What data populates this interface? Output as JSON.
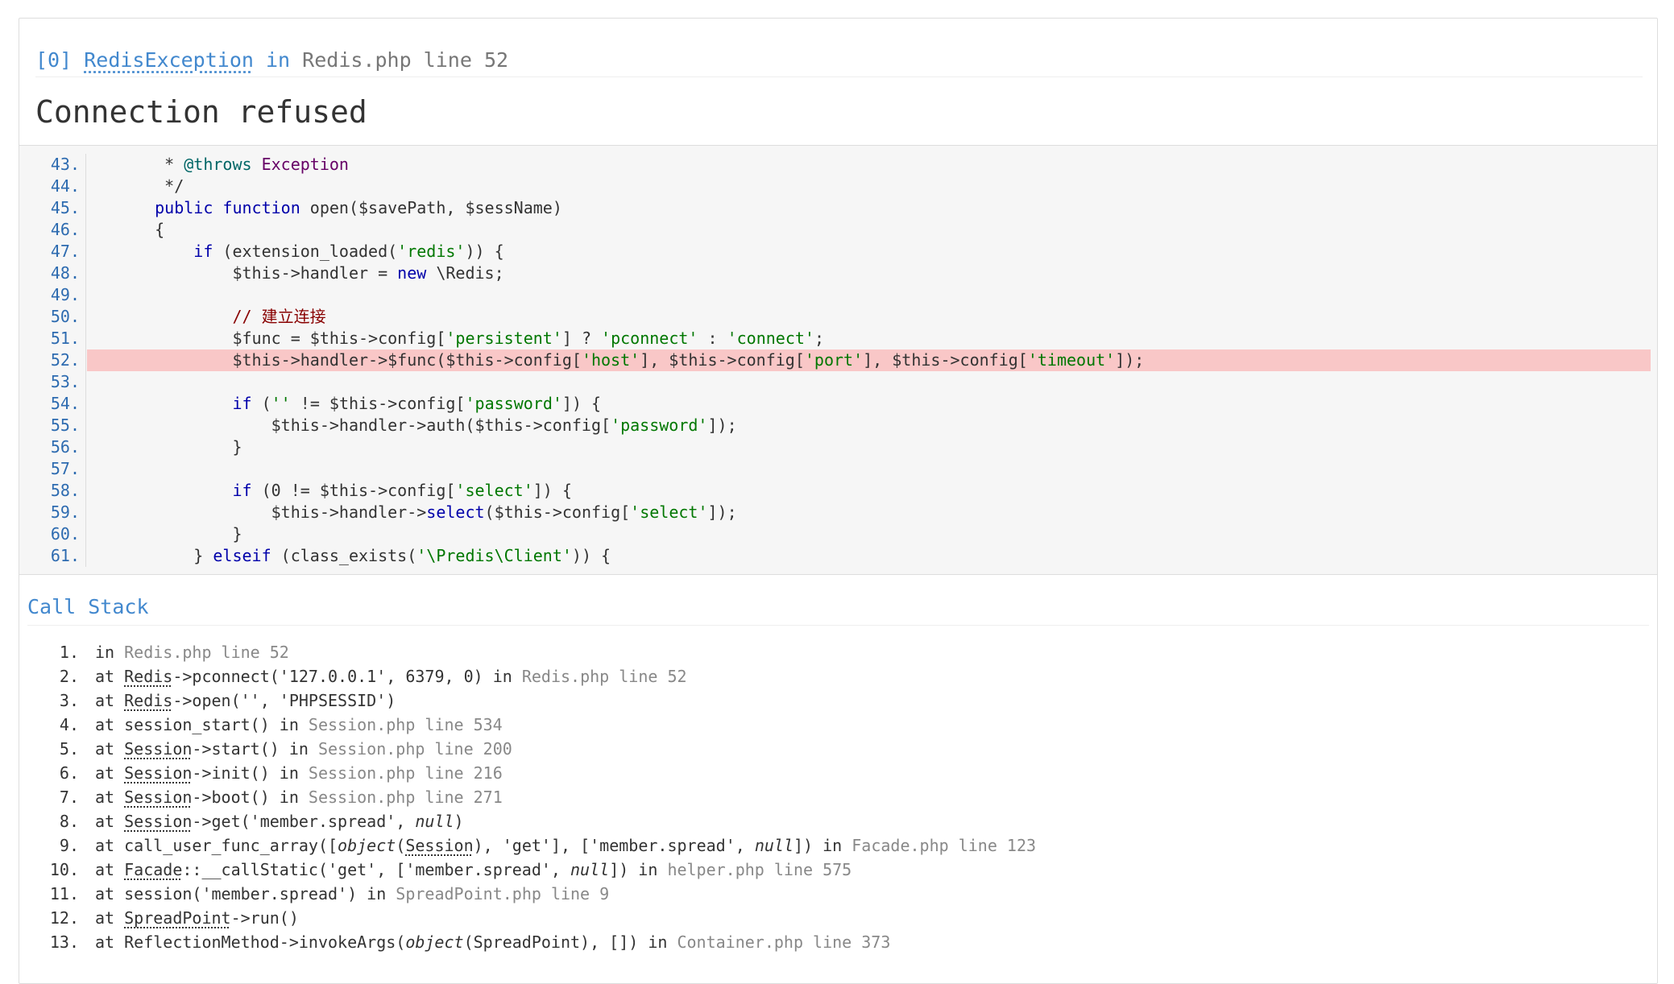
{
  "exception": {
    "index": "[0]",
    "class_name": "RedisException",
    "in_word": "in",
    "location": "Redis.php line 52",
    "message": "Connection refused"
  },
  "source": {
    "lines": [
      {
        "n": "43.",
        "segs": [
          [
            "",
            "    * "
          ],
          [
            "cmt2",
            "@throws"
          ],
          [
            "",
            " "
          ],
          [
            "cls",
            "Exception"
          ]
        ]
      },
      {
        "n": "44.",
        "segs": [
          [
            "",
            "    */"
          ]
        ]
      },
      {
        "n": "45.",
        "segs": [
          [
            "",
            "   "
          ],
          [
            "kw",
            "public function"
          ],
          [
            "",
            " open($savePath, $sessName)"
          ]
        ]
      },
      {
        "n": "46.",
        "segs": [
          [
            "",
            "   {"
          ]
        ]
      },
      {
        "n": "47.",
        "segs": [
          [
            "",
            "       "
          ],
          [
            "kw",
            "if"
          ],
          [
            "",
            " (extension_loaded("
          ],
          [
            "str",
            "'redis'"
          ],
          [
            "",
            ")) {"
          ]
        ]
      },
      {
        "n": "48.",
        "segs": [
          [
            "",
            "           $this->handler = "
          ],
          [
            "kw",
            "new"
          ],
          [
            "",
            " \\Redis;"
          ]
        ]
      },
      {
        "n": "49.",
        "segs": [
          [
            "",
            ""
          ]
        ]
      },
      {
        "n": "50.",
        "segs": [
          [
            "",
            "           "
          ],
          [
            "cmt",
            "// 建立连接"
          ]
        ]
      },
      {
        "n": "51.",
        "segs": [
          [
            "",
            "           $func = $this->config["
          ],
          [
            "str",
            "'persistent'"
          ],
          [
            "",
            "] ? "
          ],
          [
            "str",
            "'pconnect'"
          ],
          [
            "",
            " : "
          ],
          [
            "str",
            "'connect'"
          ],
          [
            "",
            ";"
          ]
        ]
      },
      {
        "n": "52.",
        "hl": true,
        "segs": [
          [
            "",
            "           $this->handler->$func($this->config["
          ],
          [
            "str",
            "'host'"
          ],
          [
            "",
            "], $this->config["
          ],
          [
            "str",
            "'port'"
          ],
          [
            "",
            "], $this->config["
          ],
          [
            "str",
            "'timeout'"
          ],
          [
            "",
            "]);"
          ]
        ]
      },
      {
        "n": "53.",
        "segs": [
          [
            "",
            ""
          ]
        ]
      },
      {
        "n": "54.",
        "segs": [
          [
            "",
            "           "
          ],
          [
            "kw",
            "if"
          ],
          [
            "",
            " ("
          ],
          [
            "str",
            "''"
          ],
          [
            "",
            " != $this->config["
          ],
          [
            "str",
            "'password'"
          ],
          [
            "",
            "]) {"
          ]
        ]
      },
      {
        "n": "55.",
        "segs": [
          [
            "",
            "               $this->handler->auth($this->config["
          ],
          [
            "str",
            "'password'"
          ],
          [
            "",
            "]);"
          ]
        ]
      },
      {
        "n": "56.",
        "segs": [
          [
            "",
            "           }"
          ]
        ]
      },
      {
        "n": "57.",
        "segs": [
          [
            "",
            ""
          ]
        ]
      },
      {
        "n": "58.",
        "segs": [
          [
            "",
            "           "
          ],
          [
            "kw",
            "if"
          ],
          [
            "",
            " (0 != $this->config["
          ],
          [
            "str",
            "'select'"
          ],
          [
            "",
            "]) {"
          ]
        ]
      },
      {
        "n": "59.",
        "segs": [
          [
            "",
            "               $this->handler->"
          ],
          [
            "kw",
            "select"
          ],
          [
            "",
            "($this->config["
          ],
          [
            "str",
            "'select'"
          ],
          [
            "",
            "]);"
          ]
        ]
      },
      {
        "n": "60.",
        "segs": [
          [
            "",
            "           }"
          ]
        ]
      },
      {
        "n": "61.",
        "segs": [
          [
            "",
            "       } "
          ],
          [
            "kw",
            "elseif"
          ],
          [
            "",
            " (class_exists("
          ],
          [
            "str",
            "'\\Predis\\Client'"
          ],
          [
            "",
            ")) {"
          ]
        ]
      }
    ]
  },
  "call_stack": {
    "title": "Call Stack",
    "frames": [
      {
        "n": "1.",
        "segs": [
          [
            "",
            "in "
          ],
          [
            "file",
            "Redis.php line 52"
          ]
        ]
      },
      {
        "n": "2.",
        "segs": [
          [
            "",
            "at "
          ],
          [
            "u",
            "Redis"
          ],
          [
            "",
            "->pconnect('127.0.0.1', 6379, 0) in "
          ],
          [
            "file",
            "Redis.php line 52"
          ]
        ]
      },
      {
        "n": "3.",
        "segs": [
          [
            "",
            "at "
          ],
          [
            "u",
            "Redis"
          ],
          [
            "",
            "->open('', 'PHPSESSID')"
          ]
        ]
      },
      {
        "n": "4.",
        "segs": [
          [
            "",
            "at session_start() in "
          ],
          [
            "file",
            "Session.php line 534"
          ]
        ]
      },
      {
        "n": "5.",
        "segs": [
          [
            "",
            "at "
          ],
          [
            "u",
            "Session"
          ],
          [
            "",
            "->start() in "
          ],
          [
            "file",
            "Session.php line 200"
          ]
        ]
      },
      {
        "n": "6.",
        "segs": [
          [
            "",
            "at "
          ],
          [
            "u",
            "Session"
          ],
          [
            "",
            "->init() in "
          ],
          [
            "file",
            "Session.php line 216"
          ]
        ]
      },
      {
        "n": "7.",
        "segs": [
          [
            "",
            "at "
          ],
          [
            "u",
            "Session"
          ],
          [
            "",
            "->boot() in "
          ],
          [
            "file",
            "Session.php line 271"
          ]
        ]
      },
      {
        "n": "8.",
        "segs": [
          [
            "",
            "at "
          ],
          [
            "u",
            "Session"
          ],
          [
            "",
            "->get('member.spread', "
          ],
          [
            "it",
            "null"
          ],
          [
            "",
            ")"
          ]
        ]
      },
      {
        "n": "9.",
        "segs": [
          [
            "",
            "at call_user_func_array(["
          ],
          [
            "it",
            "object"
          ],
          [
            "",
            "("
          ],
          [
            "u",
            "Session"
          ],
          [
            "",
            "), 'get'], ['member.spread', "
          ],
          [
            "it",
            "null"
          ],
          [
            "",
            "]) in "
          ],
          [
            "file",
            "Facade.php line 123"
          ]
        ]
      },
      {
        "n": "10.",
        "segs": [
          [
            "",
            "at "
          ],
          [
            "u",
            "Facade"
          ],
          [
            "",
            "::__callStatic('get', ['member.spread', "
          ],
          [
            "it",
            "null"
          ],
          [
            "",
            "]) in "
          ],
          [
            "file",
            "helper.php line 575"
          ]
        ]
      },
      {
        "n": "11.",
        "segs": [
          [
            "",
            "at session('member.spread') in "
          ],
          [
            "file",
            "SpreadPoint.php line 9"
          ]
        ]
      },
      {
        "n": "12.",
        "segs": [
          [
            "",
            "at "
          ],
          [
            "u",
            "SpreadPoint"
          ],
          [
            "",
            "->run()"
          ]
        ]
      },
      {
        "n": "13.",
        "segs": [
          [
            "",
            "at ReflectionMethod->invokeArgs("
          ],
          [
            "it",
            "object"
          ],
          [
            "",
            "(SpreadPoint), []) in "
          ],
          [
            "file",
            "Container.php line 373"
          ]
        ]
      }
    ]
  }
}
